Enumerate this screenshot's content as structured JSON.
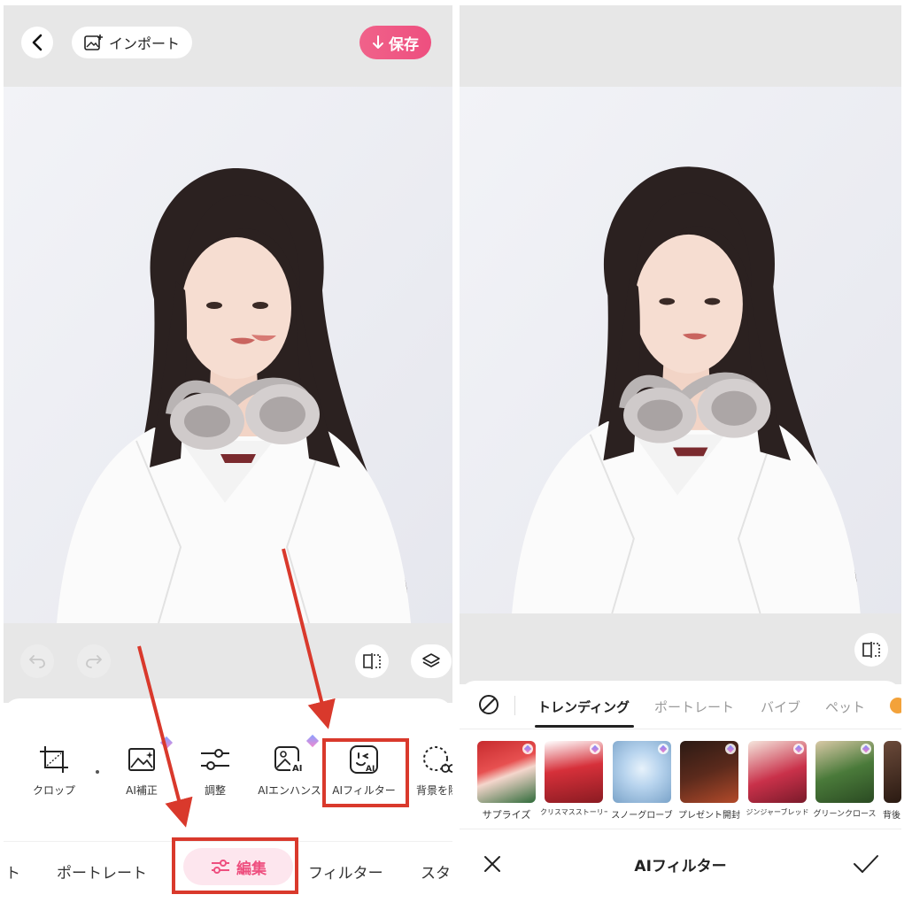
{
  "left_screen": {
    "header": {
      "back_icon": "chevron-left-icon",
      "import_label": "インポート",
      "import_icon": "image-add-icon",
      "save_label": "保存",
      "save_icon": "arrow-down-icon"
    },
    "controls": {
      "undo_icon": "undo-icon",
      "redo_icon": "redo-icon",
      "compare_icon": "compare-icon",
      "layers_icon": "layers-icon"
    },
    "tools": [
      {
        "label": "クロップ",
        "icon": "crop-icon"
      },
      {
        "label": "AI補正",
        "icon": "ai-enhance-icon"
      },
      {
        "label": "調整",
        "icon": "sliders-icon"
      },
      {
        "label": "AIエンハンス",
        "icon": "ai-enhance-photo-icon"
      },
      {
        "label": "AIフィルター",
        "icon": "ai-filter-face-icon"
      },
      {
        "label": "背景を除",
        "icon": "background-remove-icon"
      }
    ],
    "tabs": [
      {
        "label": "ト"
      },
      {
        "label": "ポートレート"
      },
      {
        "label": "編集",
        "active": true,
        "icon": "sliders-icon"
      },
      {
        "label": "フィルター"
      },
      {
        "label": "スタ"
      }
    ]
  },
  "right_screen": {
    "compare_icon": "compare-icon",
    "category_tabs": [
      {
        "label": "トレンディング",
        "active": true
      },
      {
        "label": "ポートレート"
      },
      {
        "label": "バイブ"
      },
      {
        "label": "ペット"
      }
    ],
    "none_icon": "no-filter-icon",
    "filters": [
      {
        "label": "サプライズ"
      },
      {
        "label": "クリスマスストーリー"
      },
      {
        "label": "スノーグローブ"
      },
      {
        "label": "プレゼント開封"
      },
      {
        "label": "ジンジャーブレッド"
      },
      {
        "label": "グリーンクロース"
      },
      {
        "label": "背後"
      }
    ],
    "footer": {
      "title": "AIフィルター",
      "cancel_icon": "close-icon",
      "confirm_icon": "check-icon"
    }
  },
  "colors": {
    "accent_pink": "#ee4f7f",
    "annotation_red": "#d9392c"
  }
}
